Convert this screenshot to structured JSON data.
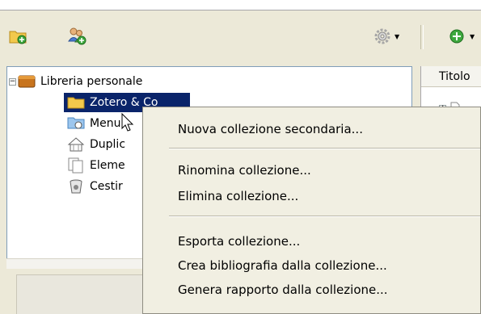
{
  "toolbar": {
    "new_collection_icon": "folder-add-icon",
    "new_group_icon": "group-add-icon",
    "actions_icon": "gear-icon",
    "new_item_icon": "add-icon"
  },
  "tree": {
    "items": [
      {
        "label": "Libreria personale",
        "icon": "library-icon",
        "expanded": true
      },
      {
        "label": "Zotero & Co",
        "icon": "folder-icon",
        "selected": true
      },
      {
        "label": "Menu",
        "icon": "saved-search-icon"
      },
      {
        "label": "Duplic",
        "icon": "duplicates-icon"
      },
      {
        "label": "Eleme",
        "icon": "unfiled-icon"
      },
      {
        "label": "Cestir",
        "icon": "trash-icon"
      }
    ]
  },
  "items_pane": {
    "column_header": "Titolo"
  },
  "context_menu": {
    "groups": [
      [
        "Nuova collezione secondaria..."
      ],
      [
        "Rinomina collezione...",
        "Elimina collezione..."
      ],
      [
        "Esporta collezione...",
        "Crea bibliografia dalla collezione...",
        "Genera rapporto dalla collezione..."
      ]
    ],
    "items": {
      "new_subcollection": "Nuova collezione secondaria...",
      "rename": "Rinomina collezione...",
      "delete": "Elimina collezione...",
      "export": "Esporta collezione...",
      "bibliography": "Crea bibliografia dalla collezione...",
      "report": "Genera rapporto dalla collezione..."
    }
  },
  "colors": {
    "selection": "#0a246a",
    "menu_bg": "#f1efe2",
    "window_bg": "#ece9d8",
    "folder": "#f2c94c"
  }
}
